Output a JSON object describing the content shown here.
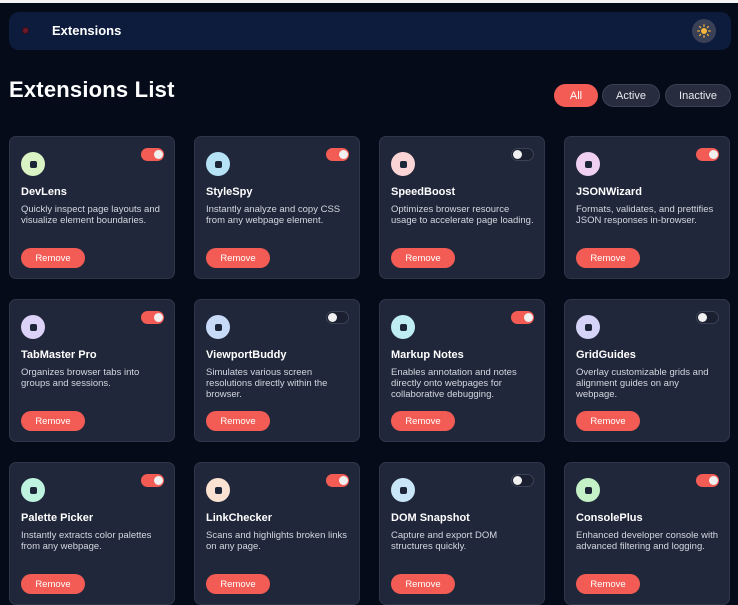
{
  "header": {
    "title": "Extensions",
    "theme_icon": "sun-icon"
  },
  "page": {
    "title": "Extensions List"
  },
  "filters": [
    {
      "label": "All",
      "active": true
    },
    {
      "label": "Active",
      "active": false
    },
    {
      "label": "Inactive",
      "active": false
    }
  ],
  "colors": {
    "accent": "#f25c54",
    "card": "#21273a",
    "background": "#060b19",
    "navbar": "#0d1b3d"
  },
  "extensions": [
    {
      "name": "DevLens",
      "description": "Quickly inspect page layouts and visualize element boundaries.",
      "enabled": true,
      "icon": "devlens-icon",
      "icon_color": "#d9f3c4",
      "remove_label": "Remove"
    },
    {
      "name": "StyleSpy",
      "description": "Instantly analyze and copy CSS from any webpage element.",
      "enabled": true,
      "icon": "stylespy-icon",
      "icon_color": "#b6e2f6",
      "remove_label": "Remove"
    },
    {
      "name": "SpeedBoost",
      "description": "Optimizes browser resource usage to accelerate page loading.",
      "enabled": false,
      "icon": "speedboost-icon",
      "icon_color": "#fbd5d6",
      "remove_label": "Remove"
    },
    {
      "name": "JSONWizard",
      "description": "Formats, validates, and prettifies JSON responses in-browser.",
      "enabled": true,
      "icon": "jsonwizard-icon",
      "icon_color": "#f0d0f2",
      "remove_label": "Remove"
    },
    {
      "name": "TabMaster Pro",
      "description": "Organizes browser tabs into groups and sessions.",
      "enabled": true,
      "icon": "tabmaster-icon",
      "icon_color": "#dcd2f7",
      "remove_label": "Remove"
    },
    {
      "name": "ViewportBuddy",
      "description": "Simulates various screen resolutions directly within the browser.",
      "enabled": false,
      "icon": "viewportbuddy-icon",
      "icon_color": "#c7daf8",
      "remove_label": "Remove"
    },
    {
      "name": "Markup Notes",
      "description": "Enables annotation and notes directly onto webpages for collaborative debugging.",
      "enabled": true,
      "icon": "markupnotes-icon",
      "icon_color": "#bfeef2",
      "remove_label": "Remove"
    },
    {
      "name": "GridGuides",
      "description": "Overlay customizable grids and alignment guides on any webpage.",
      "enabled": false,
      "icon": "gridguides-icon",
      "icon_color": "#d6d3f8",
      "remove_label": "Remove"
    },
    {
      "name": "Palette Picker",
      "description": "Instantly extracts color palettes from any webpage.",
      "enabled": true,
      "icon": "palettepicker-icon",
      "icon_color": "#bdf3df",
      "remove_label": "Remove"
    },
    {
      "name": "LinkChecker",
      "description": "Scans and highlights broken links on any page.",
      "enabled": true,
      "icon": "linkchecker-icon",
      "icon_color": "#fbe2d3",
      "remove_label": "Remove"
    },
    {
      "name": "DOM Snapshot",
      "description": "Capture and export DOM structures quickly.",
      "enabled": false,
      "icon": "domsnapshot-icon",
      "icon_color": "#c9e6f8",
      "remove_label": "Remove"
    },
    {
      "name": "ConsolePlus",
      "description": "Enhanced developer console with advanced filtering and logging.",
      "enabled": true,
      "icon": "consoleplus-icon",
      "icon_color": "#c5f1c6",
      "remove_label": "Remove"
    }
  ]
}
